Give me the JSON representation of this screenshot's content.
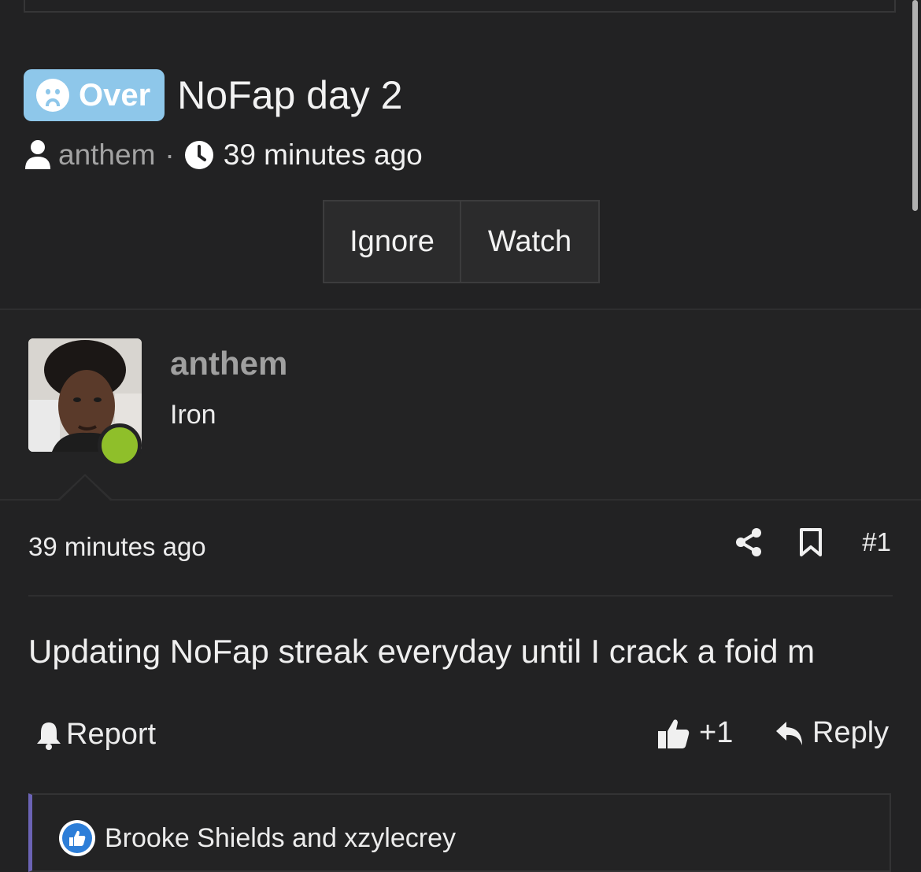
{
  "thread": {
    "prefix": "Over",
    "title": "NoFap day 2",
    "author": "anthem",
    "separator": "·",
    "time": "39 minutes ago"
  },
  "buttons": {
    "ignore": "Ignore",
    "watch": "Watch"
  },
  "post": {
    "username": "anthem",
    "user_title": "Iron",
    "time": "39 minutes ago",
    "number": "#1",
    "body": "Updating NoFap streak everyday until I crack a foid m",
    "report_label": "Report",
    "like_count": "+1",
    "reply_label": "Reply",
    "reactions_text": "Brooke Shields and xzylecrey"
  },
  "colors": {
    "background": "#222223",
    "prefix_bg": "#8ec7ea",
    "online": "#8fbf2a",
    "reaction_bar": "#6b63b5",
    "like_blue": "#2d7ed8"
  },
  "icons": [
    "sad-face-icon",
    "user-icon",
    "clock-icon",
    "share-icon",
    "bookmark-icon",
    "bell-icon",
    "thumbs-up-icon",
    "reply-icon"
  ]
}
